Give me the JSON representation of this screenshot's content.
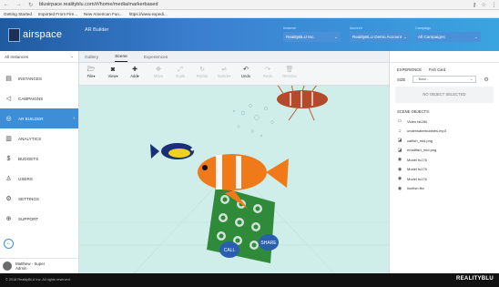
{
  "browser": {
    "url": "blusirpace.realityblu.com/#/home/media/markerbased",
    "bookmarks": [
      "Getting Started",
      "Imported From Fire...",
      "New American Fun...",
      "https://www.expedi..."
    ]
  },
  "app": {
    "logo_text": "airspace",
    "title": "AR Builder",
    "selectors": [
      {
        "label": "Instance",
        "value": "RealityBLU Inc."
      },
      {
        "label": "Account",
        "value": "RealityBLU Demo Account"
      },
      {
        "label": "Campaign",
        "value": "All Campaigns"
      }
    ]
  },
  "sidebar": {
    "top_label": "All Instances",
    "items": [
      {
        "label": "INSTANCES",
        "icon": "building-icon"
      },
      {
        "label": "CAMPAIGNS",
        "icon": "megaphone-icon"
      },
      {
        "label": "AR BUILDER",
        "icon": "ar-builder-icon"
      },
      {
        "label": "ANALYTICS",
        "icon": "bar-chart-icon"
      },
      {
        "label": "BUDGETS",
        "icon": "dollar-icon"
      },
      {
        "label": "USERS",
        "icon": "user-icon"
      },
      {
        "label": "SETTINGS",
        "icon": "gear-icon"
      },
      {
        "label": "SUPPORT",
        "icon": "support-icon"
      }
    ],
    "user_name_line1": "Matthew - Super",
    "user_name_line2": "Admin"
  },
  "tabs": [
    "Gallery",
    "Scene",
    "Experiences"
  ],
  "toolbar": [
    {
      "label": "File",
      "icon": "folder-icon",
      "enabled": true
    },
    {
      "label": "View",
      "icon": "camera-icon",
      "enabled": true
    },
    {
      "label": "Add",
      "icon": "plus-icon",
      "enabled": true
    },
    {
      "label": "Move",
      "icon": "move-icon",
      "enabled": false
    },
    {
      "label": "Scale",
      "icon": "scale-icon",
      "enabled": false
    },
    {
      "label": "Rotate",
      "icon": "rotate-icon",
      "enabled": false
    },
    {
      "label": "Switch",
      "icon": "switch-icon",
      "enabled": false
    },
    {
      "label": "Undo",
      "icon": "undo-icon",
      "enabled": true
    },
    {
      "label": "Redo",
      "icon": "redo-icon",
      "enabled": false
    },
    {
      "label": "Remove",
      "icon": "trash-icon",
      "enabled": false
    }
  ],
  "panel": {
    "experience_label": "EXPERIENCE",
    "experience_value": "Fish Card",
    "size_label": "SIZE",
    "size_value": "- Base -",
    "no_selection": "NO OBJECT SELECTED",
    "scene_objects_title": "SCENE OBJECTS:",
    "scene_objects": [
      {
        "label": "Video fst280",
        "icon": "video-icon"
      },
      {
        "label": "underwaterbubbles.mp3",
        "icon": "music-icon"
      },
      {
        "label": "catfish_mid.png",
        "icon": "image-icon"
      },
      {
        "label": "emailfish_mid.png",
        "icon": "image-icon"
      },
      {
        "label": "Model fs176",
        "icon": "model-icon"
      },
      {
        "label": "Model fs175",
        "icon": "model-icon"
      },
      {
        "label": "Model fs176",
        "icon": "model-icon"
      },
      {
        "label": "lionfish.fbx",
        "icon": "model-icon"
      }
    ]
  },
  "scene_buttons": [
    "CALL",
    "SHARE"
  ],
  "footer": {
    "copyright": "© 2018 RealityBLU Inc. All rights reserved.",
    "brand": "REALITYBLU"
  },
  "colors": {
    "header_start": "#1f5aa0",
    "header_end": "#3aa4e0",
    "active_nav": "#3d8ed6",
    "canvas_bg": "#cfeee9"
  }
}
